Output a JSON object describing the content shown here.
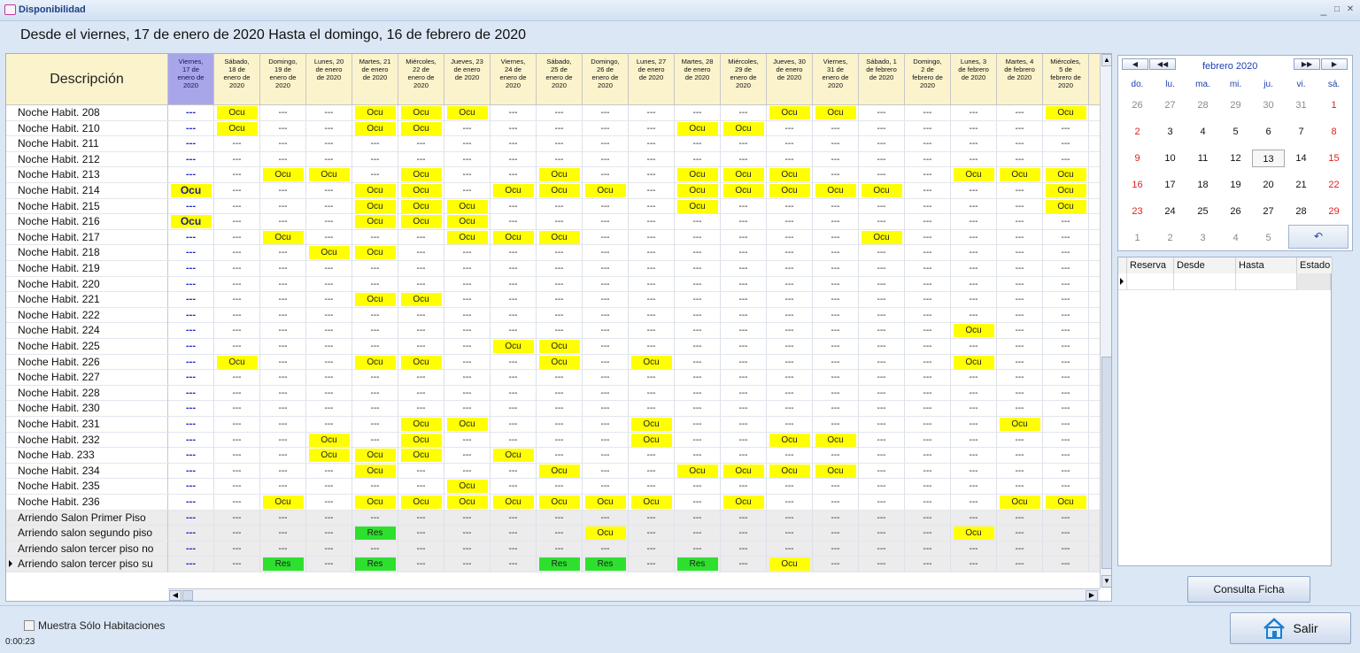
{
  "window": {
    "title": "Disponibilidad",
    "minimize": "_",
    "maximize": "□",
    "close": "✕"
  },
  "range_label": "Desde el viernes, 17 de enero de 2020 Hasta el domingo, 16 de febrero de 2020",
  "grid": {
    "description_header": "Descripción",
    "dates": [
      [
        "Viernes,",
        "17 de",
        "enero de",
        "2020"
      ],
      [
        "Sábado,",
        "18 de",
        "enero de",
        "2020"
      ],
      [
        "Domingo,",
        "19 de",
        "enero de",
        "2020"
      ],
      [
        "Lunes, 20",
        "de enero",
        "de 2020",
        ""
      ],
      [
        "Martes, 21",
        "de enero",
        "de 2020",
        ""
      ],
      [
        "Miércoles,",
        "22 de",
        "enero de",
        "2020"
      ],
      [
        "Jueves, 23",
        "de enero",
        "de 2020",
        ""
      ],
      [
        "Viernes,",
        "24 de",
        "enero de",
        "2020"
      ],
      [
        "Sábado,",
        "25 de",
        "enero de",
        "2020"
      ],
      [
        "Domingo,",
        "26 de",
        "enero de",
        "2020"
      ],
      [
        "Lunes, 27",
        "de enero",
        "de 2020",
        ""
      ],
      [
        "Martes, 28",
        "de enero",
        "de 2020",
        ""
      ],
      [
        "Miércoles,",
        "29 de",
        "enero de",
        "2020"
      ],
      [
        "Jueves, 30",
        "de enero",
        "de 2020",
        ""
      ],
      [
        "Viernes,",
        "31 de",
        "enero de",
        "2020"
      ],
      [
        "Sábado, 1",
        "de febrero",
        "de 2020",
        ""
      ],
      [
        "Domingo,",
        "2 de",
        "febrero de",
        "2020"
      ],
      [
        "Lunes, 3",
        "de febrero",
        "de 2020",
        ""
      ],
      [
        "Martes, 4",
        "de febrero",
        "de 2020",
        ""
      ],
      [
        "Miércoles,",
        "5 de",
        "febrero de",
        "2020"
      ],
      [
        "V",
        "k",
        "r",
        "L"
      ]
    ],
    "rows": [
      {
        "label": "Noche Habit. 208",
        "cells": [
          "---",
          "Ocu",
          "---",
          "---",
          "Ocu",
          "Ocu",
          "Ocu",
          "---",
          "---",
          "---",
          "---",
          "---",
          "---",
          "Ocu",
          "Ocu",
          "---",
          "---",
          "---",
          "---",
          "Ocu",
          "Oc"
        ]
      },
      {
        "label": "Noche Habit. 210",
        "cells": [
          "---",
          "Ocu",
          "---",
          "---",
          "Ocu",
          "Ocu",
          "---",
          "---",
          "---",
          "---",
          "---",
          "Ocu",
          "Ocu",
          "---",
          "---",
          "---",
          "---",
          "---",
          "---",
          "---",
          "--"
        ]
      },
      {
        "label": "Noche Habit. 211",
        "cells": [
          "---",
          "---",
          "---",
          "---",
          "---",
          "---",
          "---",
          "---",
          "---",
          "---",
          "---",
          "---",
          "---",
          "---",
          "---",
          "---",
          "---",
          "---",
          "---",
          "---",
          "--"
        ]
      },
      {
        "label": "Noche Habit. 212",
        "cells": [
          "---",
          "---",
          "---",
          "---",
          "---",
          "---",
          "---",
          "---",
          "---",
          "---",
          "---",
          "---",
          "---",
          "---",
          "---",
          "---",
          "---",
          "---",
          "---",
          "---",
          "--"
        ]
      },
      {
        "label": "Noche Habit. 213",
        "cells": [
          "---",
          "---",
          "Ocu",
          "Ocu",
          "---",
          "Ocu",
          "---",
          "---",
          "Ocu",
          "---",
          "---",
          "Ocu",
          "Ocu",
          "Ocu",
          "---",
          "---",
          "---",
          "Ocu",
          "Ocu",
          "Ocu",
          "--"
        ]
      },
      {
        "label": "Noche Habit. 214",
        "cells": [
          "Ocu",
          "---",
          "---",
          "---",
          "Ocu",
          "Ocu",
          "---",
          "Ocu",
          "Ocu",
          "Ocu",
          "---",
          "Ocu",
          "Ocu",
          "Ocu",
          "Ocu",
          "Ocu",
          "---",
          "---",
          "---",
          "Ocu",
          "--"
        ]
      },
      {
        "label": "Noche Habit. 215",
        "cells": [
          "---",
          "---",
          "---",
          "---",
          "Ocu",
          "Ocu",
          "Ocu",
          "---",
          "---",
          "---",
          "---",
          "Ocu",
          "---",
          "---",
          "---",
          "---",
          "---",
          "---",
          "---",
          "Ocu",
          "Oc"
        ]
      },
      {
        "label": "Noche Habit. 216",
        "cells": [
          "Ocu",
          "---",
          "---",
          "---",
          "Ocu",
          "Ocu",
          "Ocu",
          "---",
          "---",
          "---",
          "---",
          "---",
          "---",
          "---",
          "---",
          "---",
          "---",
          "---",
          "---",
          "---",
          "--"
        ]
      },
      {
        "label": "Noche Habit. 217",
        "cells": [
          "---",
          "---",
          "Ocu",
          "---",
          "---",
          "---",
          "Ocu",
          "Ocu",
          "Ocu",
          "---",
          "---",
          "---",
          "---",
          "---",
          "---",
          "Ocu",
          "---",
          "---",
          "---",
          "---",
          "--"
        ]
      },
      {
        "label": "Noche Habit. 218",
        "cells": [
          "---",
          "---",
          "---",
          "Ocu",
          "Ocu",
          "---",
          "---",
          "---",
          "---",
          "---",
          "---",
          "---",
          "---",
          "---",
          "---",
          "---",
          "---",
          "---",
          "---",
          "---",
          "--"
        ]
      },
      {
        "label": "Noche Habit. 219",
        "cells": [
          "---",
          "---",
          "---",
          "---",
          "---",
          "---",
          "---",
          "---",
          "---",
          "---",
          "---",
          "---",
          "---",
          "---",
          "---",
          "---",
          "---",
          "---",
          "---",
          "---",
          "--"
        ]
      },
      {
        "label": "Noche Habit. 220",
        "cells": [
          "---",
          "---",
          "---",
          "---",
          "---",
          "---",
          "---",
          "---",
          "---",
          "---",
          "---",
          "---",
          "---",
          "---",
          "---",
          "---",
          "---",
          "---",
          "---",
          "---",
          "--"
        ]
      },
      {
        "label": "Noche Habit. 221",
        "cells": [
          "---",
          "---",
          "---",
          "---",
          "Ocu",
          "Ocu",
          "---",
          "---",
          "---",
          "---",
          "---",
          "---",
          "---",
          "---",
          "---",
          "---",
          "---",
          "---",
          "---",
          "---",
          "--"
        ]
      },
      {
        "label": "Noche Habit. 222",
        "cells": [
          "---",
          "---",
          "---",
          "---",
          "---",
          "---",
          "---",
          "---",
          "---",
          "---",
          "---",
          "---",
          "---",
          "---",
          "---",
          "---",
          "---",
          "---",
          "---",
          "---",
          "--"
        ]
      },
      {
        "label": "Noche Habit. 224",
        "cells": [
          "---",
          "---",
          "---",
          "---",
          "---",
          "---",
          "---",
          "---",
          "---",
          "---",
          "---",
          "---",
          "---",
          "---",
          "---",
          "---",
          "---",
          "Ocu",
          "---",
          "---",
          "--"
        ]
      },
      {
        "label": "Noche Habit. 225",
        "cells": [
          "---",
          "---",
          "---",
          "---",
          "---",
          "---",
          "---",
          "Ocu",
          "Ocu",
          "---",
          "---",
          "---",
          "---",
          "---",
          "---",
          "---",
          "---",
          "---",
          "---",
          "---",
          "--"
        ]
      },
      {
        "label": "Noche Habit. 226",
        "cells": [
          "---",
          "Ocu",
          "---",
          "---",
          "Ocu",
          "Ocu",
          "---",
          "---",
          "Ocu",
          "---",
          "Ocu",
          "---",
          "---",
          "---",
          "---",
          "---",
          "---",
          "Ocu",
          "---",
          "---",
          "--"
        ]
      },
      {
        "label": "Noche Habit. 227",
        "cells": [
          "---",
          "---",
          "---",
          "---",
          "---",
          "---",
          "---",
          "---",
          "---",
          "---",
          "---",
          "---",
          "---",
          "---",
          "---",
          "---",
          "---",
          "---",
          "---",
          "---",
          "--"
        ]
      },
      {
        "label": "Noche Habit. 228",
        "cells": [
          "---",
          "---",
          "---",
          "---",
          "---",
          "---",
          "---",
          "---",
          "---",
          "---",
          "---",
          "---",
          "---",
          "---",
          "---",
          "---",
          "---",
          "---",
          "---",
          "---",
          "--"
        ]
      },
      {
        "label": "Noche Habit. 230",
        "cells": [
          "---",
          "---",
          "---",
          "---",
          "---",
          "---",
          "---",
          "---",
          "---",
          "---",
          "---",
          "---",
          "---",
          "---",
          "---",
          "---",
          "---",
          "---",
          "---",
          "---",
          "--"
        ]
      },
      {
        "label": "Noche Habit. 231",
        "cells": [
          "---",
          "---",
          "---",
          "---",
          "---",
          "Ocu",
          "Ocu",
          "---",
          "---",
          "---",
          "Ocu",
          "---",
          "---",
          "---",
          "---",
          "---",
          "---",
          "---",
          "Ocu",
          "---",
          "--"
        ]
      },
      {
        "label": "Noche Habit. 232",
        "cells": [
          "---",
          "---",
          "---",
          "Ocu",
          "---",
          "Ocu",
          "---",
          "---",
          "---",
          "---",
          "Ocu",
          "---",
          "---",
          "Ocu",
          "Ocu",
          "---",
          "---",
          "---",
          "---",
          "---",
          "--"
        ]
      },
      {
        "label": "Noche Hab. 233",
        "cells": [
          "---",
          "---",
          "---",
          "Ocu",
          "Ocu",
          "Ocu",
          "---",
          "Ocu",
          "---",
          "---",
          "---",
          "---",
          "---",
          "---",
          "---",
          "---",
          "---",
          "---",
          "---",
          "---",
          "--"
        ]
      },
      {
        "label": "Noche Habit. 234",
        "cells": [
          "---",
          "---",
          "---",
          "---",
          "Ocu",
          "---",
          "---",
          "---",
          "Ocu",
          "---",
          "---",
          "Ocu",
          "Ocu",
          "Ocu",
          "Ocu",
          "---",
          "---",
          "---",
          "---",
          "---",
          "--"
        ]
      },
      {
        "label": "Noche Habit. 235",
        "cells": [
          "---",
          "---",
          "---",
          "---",
          "---",
          "---",
          "Ocu",
          "---",
          "---",
          "---",
          "---",
          "---",
          "---",
          "---",
          "---",
          "---",
          "---",
          "---",
          "---",
          "---",
          "--"
        ]
      },
      {
        "label": "Noche Habit. 236",
        "cells": [
          "---",
          "---",
          "Ocu",
          "---",
          "Ocu",
          "Ocu",
          "Ocu",
          "Ocu",
          "Ocu",
          "Ocu",
          "Ocu",
          "---",
          "Ocu",
          "---",
          "---",
          "---",
          "---",
          "---",
          "Ocu",
          "Ocu",
          "Oc"
        ]
      },
      {
        "label": "Arriendo Salon Primer Piso",
        "cells": [
          "---",
          "---",
          "---",
          "---",
          "---",
          "---",
          "---",
          "---",
          "---",
          "---",
          "---",
          "---",
          "---",
          "---",
          "---",
          "---",
          "---",
          "---",
          "---",
          "---",
          "--"
        ]
      },
      {
        "label": "Arriendo salon segundo piso",
        "cells": [
          "---",
          "---",
          "---",
          "---",
          "Res",
          "---",
          "---",
          "---",
          "---",
          "Ocu",
          "---",
          "---",
          "---",
          "---",
          "---",
          "---",
          "---",
          "Ocu",
          "---",
          "---",
          "--"
        ]
      },
      {
        "label": "Arriendo salon tercer piso no",
        "cells": [
          "---",
          "---",
          "---",
          "---",
          "---",
          "---",
          "---",
          "---",
          "---",
          "---",
          "---",
          "---",
          "---",
          "---",
          "---",
          "---",
          "---",
          "---",
          "---",
          "---",
          "--"
        ]
      },
      {
        "label": "Arriendo salon tercer piso su",
        "cells": [
          "---",
          "---",
          "Res",
          "---",
          "Res",
          "---",
          "---",
          "---",
          "Res",
          "Res",
          "---",
          "Res",
          "---",
          "Ocu",
          "---",
          "---",
          "---",
          "---",
          "---",
          "---",
          "--"
        ]
      }
    ],
    "gray_rows_from": 26,
    "selected_row": 29
  },
  "calendar": {
    "title": "febrero 2020",
    "prev_btn": "◀",
    "prev_fast_btn": "◀◀",
    "next_fast_btn": "▶▶",
    "next_btn": "▶",
    "day_names": [
      "do.",
      "lu.",
      "ma.",
      "mi.",
      "ju.",
      "vi.",
      "sá."
    ],
    "weeks": [
      [
        "26",
        "27",
        "28",
        "29",
        "30",
        "31",
        "1"
      ],
      [
        "2",
        "3",
        "4",
        "5",
        "6",
        "7",
        "8"
      ],
      [
        "9",
        "10",
        "11",
        "12",
        "13",
        "14",
        "15"
      ],
      [
        "16",
        "17",
        "18",
        "19",
        "20",
        "21",
        "22"
      ],
      [
        "23",
        "24",
        "25",
        "26",
        "27",
        "28",
        "29"
      ],
      [
        "1",
        "2",
        "3",
        "4",
        "5"
      ]
    ],
    "today_btn": "↶"
  },
  "reservations": {
    "columns": [
      "Reserva",
      "Desde",
      "Hasta",
      "Estado"
    ]
  },
  "buttons": {
    "ficha": "Consulta Ficha",
    "salir": "Salir"
  },
  "filter": {
    "label": "Muestra Sólo Habitaciones",
    "checked": false
  },
  "timer": "0:00:23",
  "colors": {
    "occupied": "#ffff00",
    "reserved": "#2ee02e",
    "selected_header": "#a8a6e8",
    "header_bg": "#fbf3cc"
  }
}
